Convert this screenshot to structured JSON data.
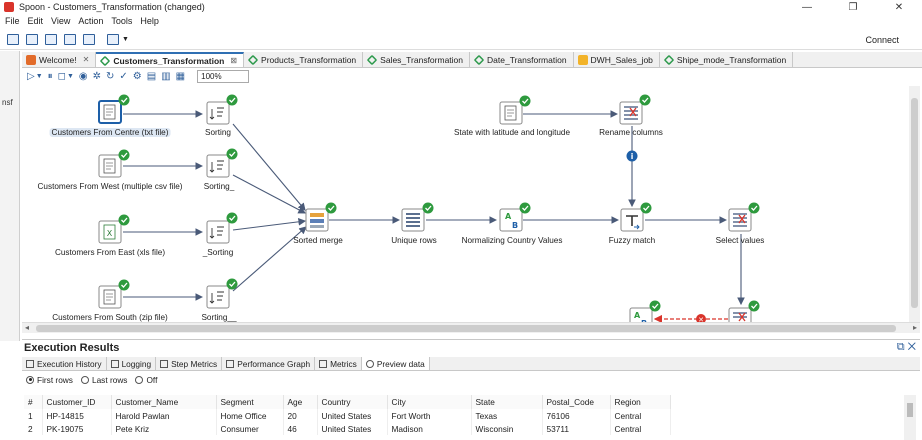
{
  "window": {
    "title": "Spoon - Customers_Transformation (changed)",
    "controls": [
      "—",
      "❐",
      "✕"
    ]
  },
  "menu": [
    "File",
    "Edit",
    "View",
    "Action",
    "Tools",
    "Help"
  ],
  "toolbar": {
    "connect_label": "Connect"
  },
  "left_strip_text": "nsf",
  "tabs": [
    {
      "label": "Welcome!",
      "kind": "welcome",
      "active": false
    },
    {
      "label": "Customers_Transformation",
      "kind": "trans",
      "active": true
    },
    {
      "label": "Products_Transformation",
      "kind": "trans",
      "active": false
    },
    {
      "label": "Sales_Transformation",
      "kind": "trans",
      "active": false
    },
    {
      "label": "Date_Transformation",
      "kind": "trans",
      "active": false
    },
    {
      "label": "DWH_Sales_job",
      "kind": "job",
      "active": false
    },
    {
      "label": "Shipe_mode_Transformation",
      "kind": "trans",
      "active": false
    }
  ],
  "zoom": "100%",
  "steps": [
    {
      "label": "Customers From Centre (txt file)",
      "selected": true
    },
    {
      "label": "Sorting"
    },
    {
      "label": "Customers From West (multiple csv file)"
    },
    {
      "label": "Sorting_"
    },
    {
      "label": "Customers From East (xls file)"
    },
    {
      "label": "_Sorting"
    },
    {
      "label": "Customers From South (zip file)"
    },
    {
      "label": "Sorting__"
    },
    {
      "label": "Sorted merge"
    },
    {
      "label": "Unique rows"
    },
    {
      "label": "Normalizing Country Values"
    },
    {
      "label": "State with latitude and longitude"
    },
    {
      "label": "Rename columns"
    },
    {
      "label": "Fuzzy match"
    },
    {
      "label": "Select values"
    }
  ],
  "results": {
    "title": "Execution Results",
    "tabs": [
      "Execution History",
      "Logging",
      "Step Metrics",
      "Performance Graph",
      "Metrics",
      "Preview data"
    ],
    "active_tab": "Preview data",
    "radios": [
      "First rows",
      "Last rows",
      "Off"
    ],
    "radio_selected": "First rows",
    "columns": [
      "#",
      "Customer_ID",
      "Customer_Name",
      "Segment",
      "Age",
      "Country",
      "City",
      "State",
      "Postal_Code",
      "Region"
    ],
    "rows": [
      [
        "1",
        "HP-14815",
        "Harold Pawlan",
        "Home Office",
        "20",
        "United States",
        "Fort Worth",
        "Texas",
        "76106",
        "Central"
      ],
      [
        "2",
        "PK-19075",
        "Pete Kriz",
        "Consumer",
        "46",
        "United States",
        "Madison",
        "Wisconsin",
        "53711",
        "Central"
      ]
    ]
  },
  "colors": {
    "accent": "#2f6fb3",
    "ok": "#2e9a3e",
    "error": "#d9342b",
    "info": "#1d5fa8"
  }
}
